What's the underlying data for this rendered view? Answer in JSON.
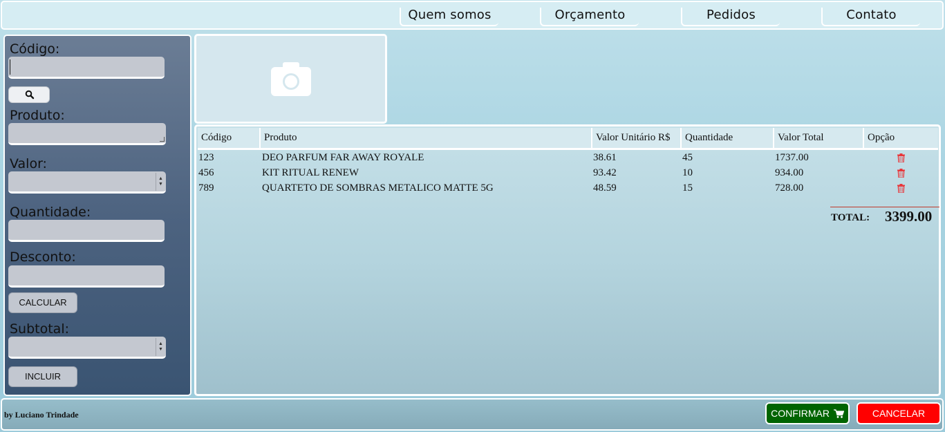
{
  "nav": {
    "items": [
      "Quem somos",
      "Orçamento",
      "Pedidos",
      "Contato"
    ]
  },
  "form": {
    "codigo_label": "Código:",
    "codigo_value": "",
    "produto_label": "Produto:",
    "valor_label": "Valor:",
    "quantidade_label": "Quantidade:",
    "desconto_label": "Desconto:",
    "calcular_label": "CALCULAR",
    "subtotal_label": "Subtotal:",
    "incluir_label": "INCLUIR",
    "search_icon": "magnifier-icon"
  },
  "image_placeholder": {
    "icon": "camera-icon"
  },
  "table": {
    "headers": [
      "Código",
      "Produto",
      "Valor Unitário R$",
      "Quantidade",
      "Valor Total",
      "Opção"
    ],
    "rows": [
      {
        "codigo": "123",
        "produto": "DEO PARFUM FAR AWAY ROYALE",
        "valor_unitario": "38.61",
        "quantidade": "45",
        "valor_total": "1737.00"
      },
      {
        "codigo": "456",
        "produto": "KIT RITUAL RENEW",
        "valor_unitario": "93.42",
        "quantidade": "10",
        "valor_total": "934.00"
      },
      {
        "codigo": "789",
        "produto": "QUARTETO DE SOMBRAS METALICO MATTE 5G",
        "valor_unitario": "48.59",
        "quantidade": "15",
        "valor_total": "728.00"
      }
    ],
    "option_icon": "trash-icon",
    "total_label": "TOTAL:",
    "total_value": "3399.00"
  },
  "footer": {
    "credit": "by Luciano Trindade",
    "confirm_label": "CONFIRMAR",
    "cancel_label": "CANCELAR"
  },
  "colors": {
    "confirm": "#006400",
    "cancel": "#ff0000",
    "trash": "#e8363a"
  }
}
